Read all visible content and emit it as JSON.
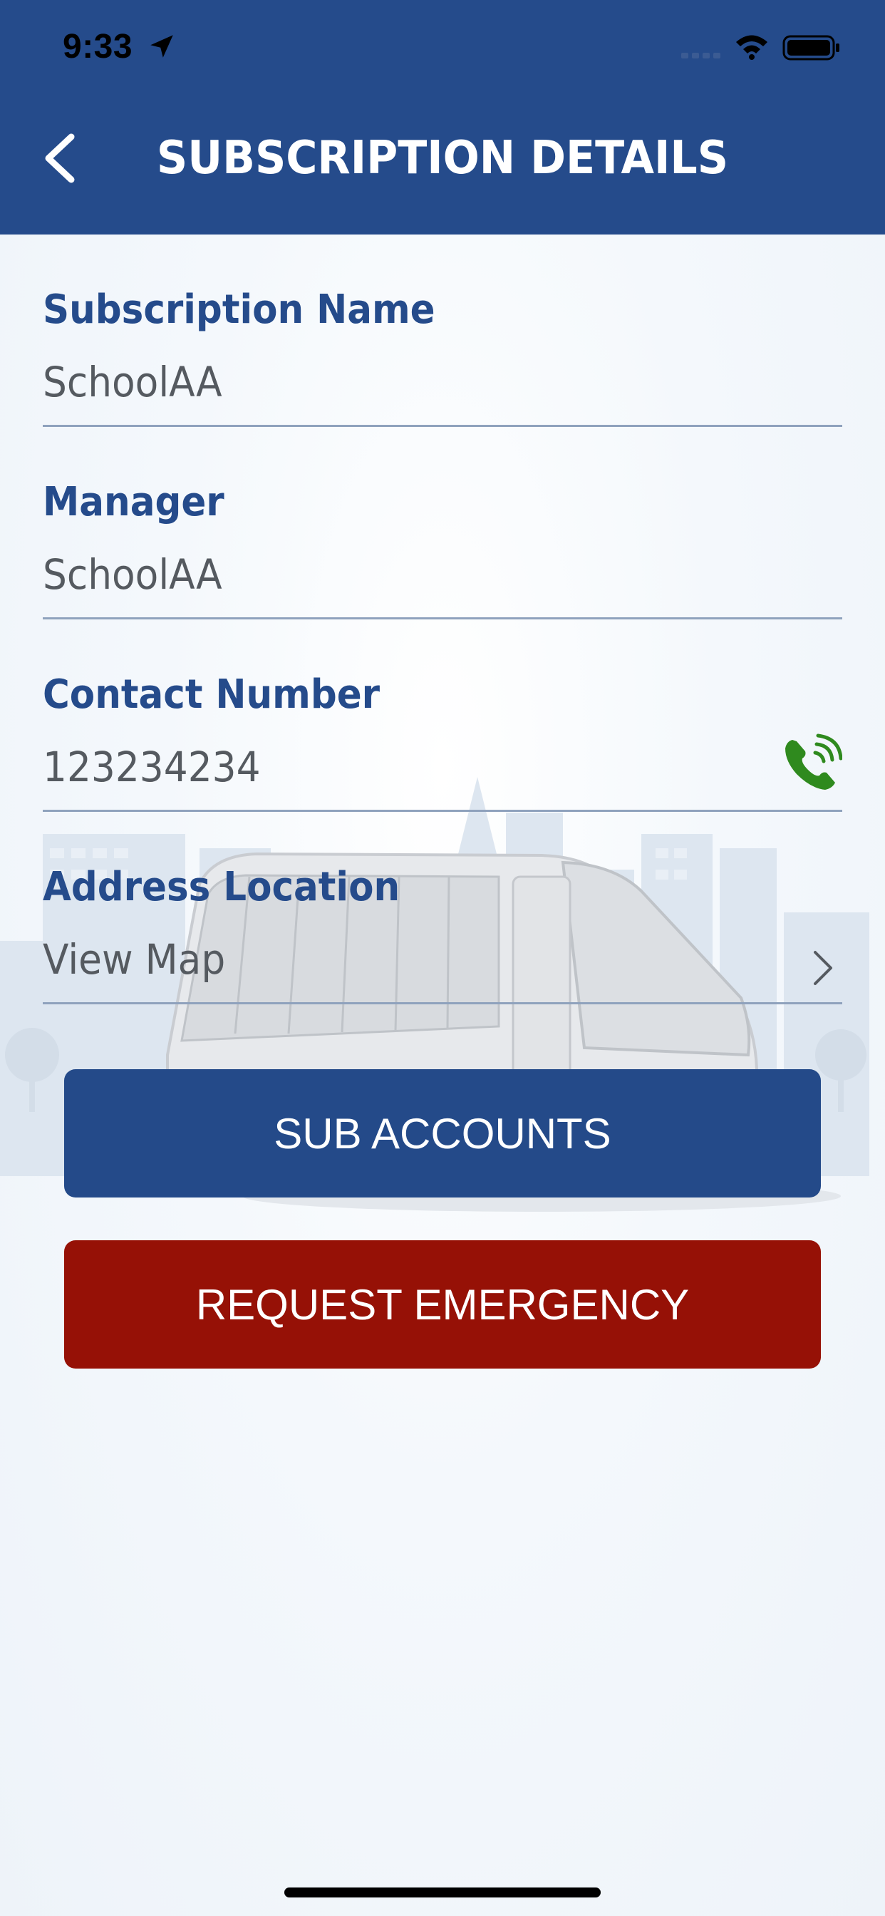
{
  "status_bar": {
    "time": "9:33",
    "icons": [
      "location-arrow-icon",
      "cellular-signal-icon",
      "wifi-icon",
      "battery-icon"
    ]
  },
  "header": {
    "title": "SUBSCRIPTION DETAILS",
    "back_icon": "chevron-left-icon",
    "background_color": "#254b8b"
  },
  "fields": [
    {
      "label": "Subscription Name",
      "value": "SchoolAA"
    },
    {
      "label": "Manager",
      "value": "SchoolAA"
    },
    {
      "label": "Contact Number",
      "value": "123234234",
      "action_icon": "phone-call-icon"
    },
    {
      "label": "Address Location",
      "value": "View Map",
      "action_icon": "chevron-right-icon"
    }
  ],
  "buttons": {
    "sub_accounts": "SUB ACCOUNTS",
    "request_emergency": "REQUEST EMERGENCY"
  },
  "colors": {
    "primary": "#254b8b",
    "danger": "#961106",
    "label": "#254b8b",
    "value": "#555a60",
    "phone_icon": "#2f8a1e"
  }
}
